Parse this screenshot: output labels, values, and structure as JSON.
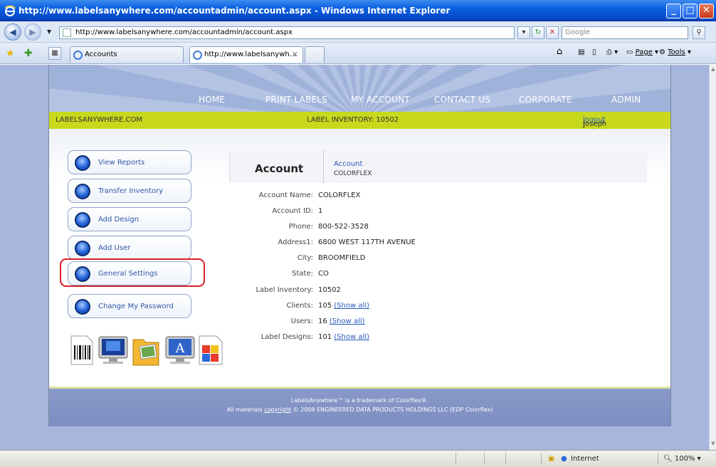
{
  "window": {
    "title": "http://www.labelsanywhere.com/accountadmin/account.aspx - Windows Internet Explorer"
  },
  "browser": {
    "address": "http://www.labelsanywhere.com/accountadmin/account.aspx",
    "search_placeholder": "Google",
    "tabs": [
      {
        "label": "Accounts"
      },
      {
        "label": "http://www.labelsanywh..."
      }
    ],
    "commands": {
      "page": "Page",
      "tools": "Tools"
    },
    "status": {
      "zone": "Internet",
      "zoom": "100%"
    }
  },
  "site": {
    "nav": [
      "HOME",
      "PRINT LABELS",
      "MY ACCOUNT",
      "CONTACT US",
      "CORPORATE",
      "ADMIN"
    ],
    "brand": "LABELSANYWHERE.COM",
    "inventory_banner": "LABEL INVENTORY: 10502",
    "user_name": "Joseph Beierl",
    "separator": "|",
    "logout": "logout",
    "menu": [
      "View Reports",
      "Transfer Inventory",
      "Add Design",
      "Add User",
      "General Settings",
      "Change My Password"
    ],
    "account": {
      "title": "Account",
      "crumb_link": "Account",
      "crumb_value": "COLORFLEX",
      "fields": [
        {
          "label": "Account Name:",
          "value": "COLORFLEX"
        },
        {
          "label": "Account ID:",
          "value": "1"
        },
        {
          "label": "Phone:",
          "value": "800-522-3528"
        },
        {
          "label": "Address1:",
          "value": "6800 WEST 117TH AVENUE"
        },
        {
          "label": "City:",
          "value": "BROOMFIELD"
        },
        {
          "label": "State:",
          "value": "CO"
        },
        {
          "label": "Label Inventory:",
          "value": "10502"
        },
        {
          "label": "Clients:",
          "value": "105",
          "link": "(Show all)"
        },
        {
          "label": "Users:",
          "value": "16",
          "link": "(Show all)"
        },
        {
          "label": "Label Designs:",
          "value": "101",
          "link": "(Show all)"
        }
      ]
    },
    "footer": {
      "line1": "LabelsAnywhere™ is a trademark of Colorflex®.",
      "line2_prefix": "All materials",
      "line2_link": "copyright",
      "line2_suffix": "© 2009 ENGINEERED DATA PRODUCTS HOLDINGS LLC (EDP Colorflex)"
    }
  },
  "colors": {
    "accent_green": "#c8d81c",
    "highlight_red": "#d8202a",
    "link_blue": "#2a5ab8"
  }
}
